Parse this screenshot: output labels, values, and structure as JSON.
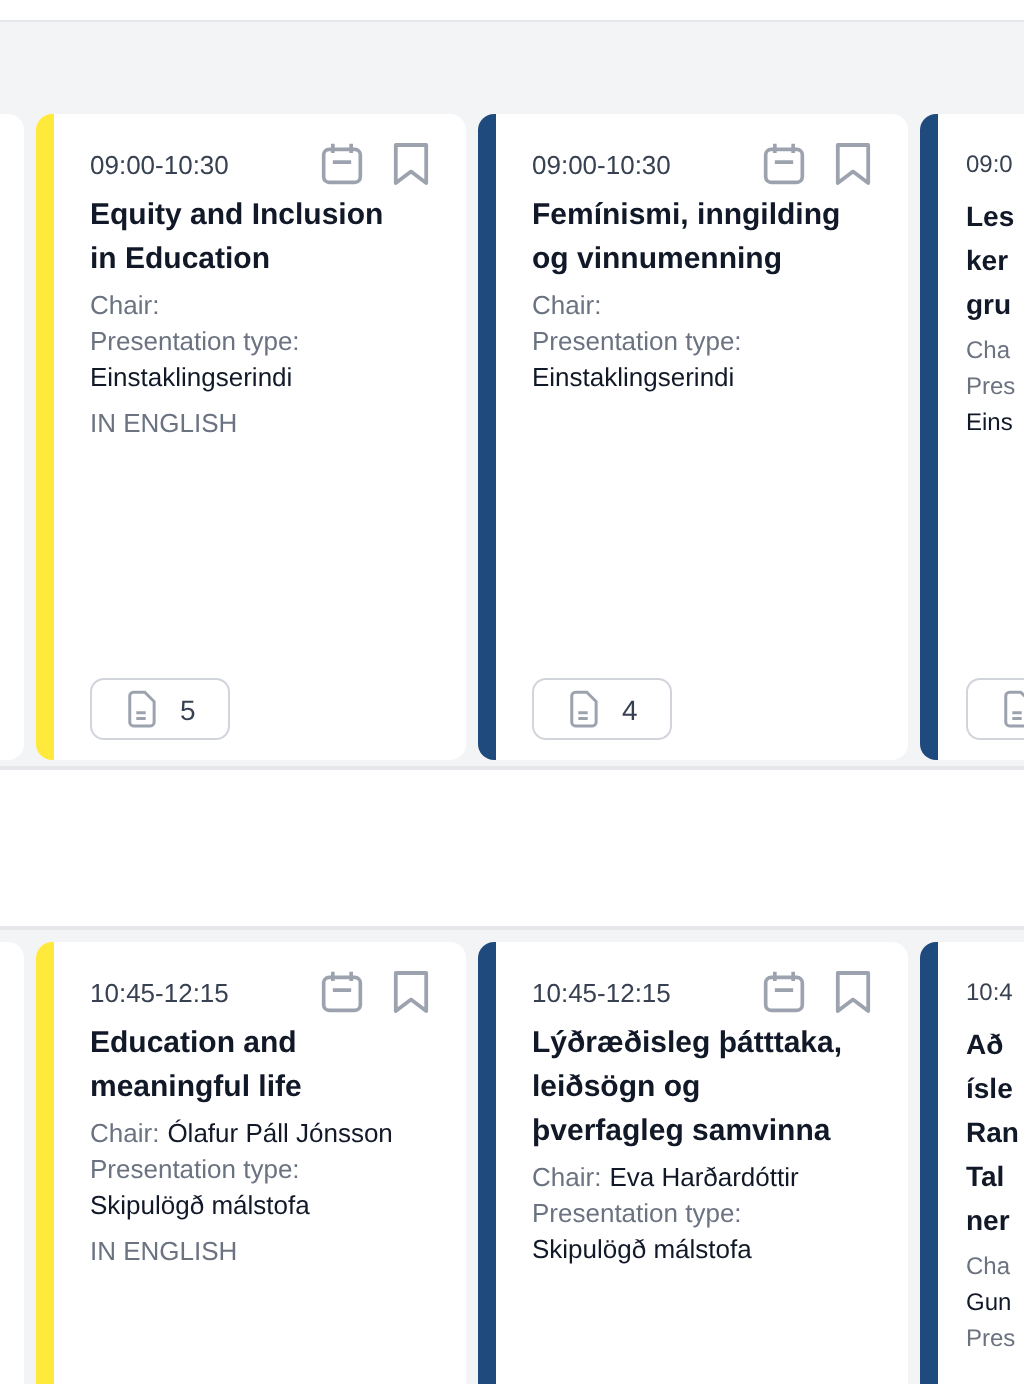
{
  "rows": [
    {
      "cards": [
        {
          "kind": "edge"
        },
        {
          "kind": "session",
          "color": "#ffe93b",
          "time": "09:00-10:30",
          "title_lines": [
            "Equity and Inclusion",
            "in Education"
          ],
          "chair_label": "Chair:",
          "type_label": "Presentation type:",
          "type": "Einstaklingserindi",
          "tag": "IN ENGLISH",
          "documents": "5"
        },
        {
          "kind": "session",
          "color": "#1f4a7e",
          "time": "09:00-10:30",
          "title_lines": [
            "Femínismi, inngilding",
            "og vinnumenning"
          ],
          "chair_label": "Chair:",
          "type_label": "Presentation type:",
          "type": "Einstaklingserindi",
          "documents": "4"
        },
        {
          "kind": "partial",
          "color": "#1f4a7e",
          "time": "09:0",
          "title_lines": [
            "Les",
            "ker",
            "gru"
          ],
          "chair_label": "Cha",
          "type_label": "Pres",
          "type": "Eins",
          "documents_button": true
        }
      ]
    },
    {
      "cards": [
        {
          "kind": "edge"
        },
        {
          "kind": "session",
          "color": "#ffe93b",
          "time": "10:45-12:15",
          "title_lines": [
            "Education and",
            "meaningful life"
          ],
          "chair_label": "Chair:",
          "chair": "Ólafur Páll Jónsson",
          "type_label": "Presentation type:",
          "type": "Skipulögð málstofa",
          "tag": "IN ENGLISH"
        },
        {
          "kind": "session",
          "color": "#1f4a7e",
          "time": "10:45-12:15",
          "title_lines": [
            "Lýðræðisleg þátttaka,",
            "leiðsögn og",
            "þverfagleg samvinna"
          ],
          "chair_label": "Chair:",
          "chair": "Eva Harðardóttir",
          "type_label": "Presentation type:",
          "type": "Skipulögð málstofa"
        },
        {
          "kind": "partial",
          "color": "#1f4a7e",
          "time": "10:4",
          "title_lines": [
            "Að",
            "ísle",
            "Ran",
            "Tal",
            "ner"
          ],
          "chair_label": "Cha",
          "chair": "Gun",
          "type_label": "Pres"
        }
      ]
    }
  ]
}
